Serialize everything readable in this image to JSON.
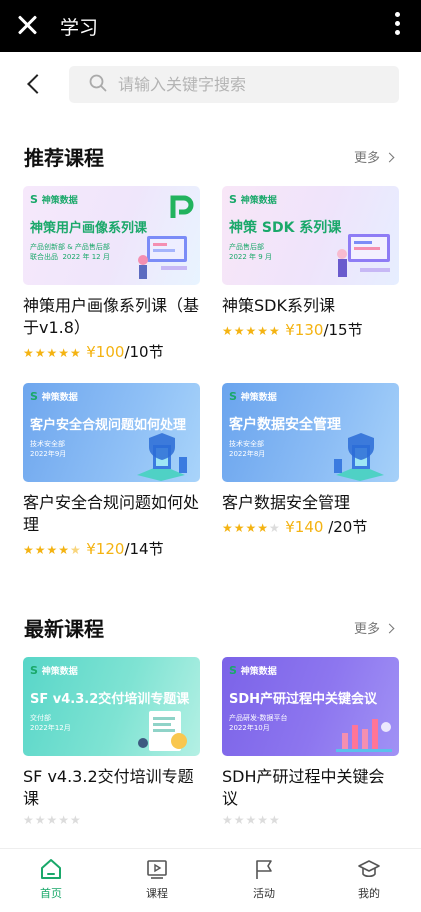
{
  "app": {
    "title": "学习"
  },
  "search": {
    "placeholder": "请输入关键字搜索"
  },
  "sections": [
    {
      "title": "推荐课程",
      "more": "更多",
      "courses": [
        {
          "title": "神策用户画像系列课（基于v1.8）",
          "thumb_brand": "神策数据",
          "thumb_headline": "神策用户画像系列课",
          "thumb_sub": "产品创新部 & 产品售后部\n联合出品  2022 年 12 月",
          "stars": 5,
          "price": "¥100",
          "lessons": "/10节"
        },
        {
          "title": "神策SDK系列课",
          "thumb_brand": "神策数据",
          "thumb_headline": "神策 SDK 系列课",
          "thumb_sub": "产品售后部\n2022 年 9 月",
          "stars": 5,
          "price": "¥130",
          "lessons": "/15节"
        },
        {
          "title": "客户安全合规问题如何处理",
          "thumb_brand": "神策数据",
          "thumb_headline": "客户安全合规问题如何处理",
          "thumb_sub": "技术安全部\n2022年9月",
          "stars": 4.5,
          "price": "¥120",
          "lessons": "/14节"
        },
        {
          "title": "客户数据安全管理",
          "thumb_brand": "神策数据",
          "thumb_headline": "客户数据安全管理",
          "thumb_sub": "技术安全部\n2022年8月",
          "stars": 4,
          "price": "¥140",
          "lessons": " /20节"
        }
      ]
    },
    {
      "title": "最新课程",
      "more": "更多",
      "courses": [
        {
          "title": "SF v4.3.2交付培训专题课",
          "thumb_brand": "神策数据",
          "thumb_headline": "SF v4.3.2交付培训专题课",
          "thumb_sub": "交付部\n2022年12月",
          "stars": 0
        },
        {
          "title": "SDH产研过程中关键会议",
          "thumb_brand": "神策数据",
          "thumb_headline": "SDH产研过程中关键会议",
          "thumb_sub": "产品研发-数据平台\n2022年10月",
          "stars": 0
        }
      ]
    }
  ],
  "tabs": [
    {
      "label": "首页",
      "icon": "home-icon",
      "active": true
    },
    {
      "label": "课程",
      "icon": "course-icon",
      "active": false
    },
    {
      "label": "活动",
      "icon": "flag-icon",
      "active": false
    },
    {
      "label": "我的",
      "icon": "graduation-cap-icon",
      "active": false
    }
  ],
  "colors": {
    "accent": "#1aa86a",
    "star": "#f4b312",
    "topbar": "#000000"
  }
}
